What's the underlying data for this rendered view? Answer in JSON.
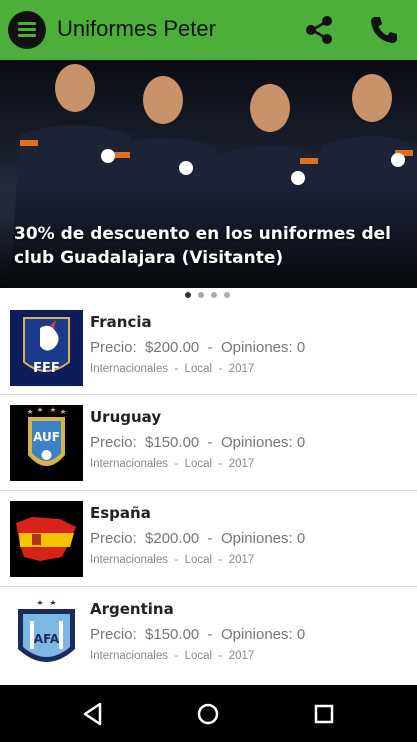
{
  "appbar": {
    "title": "Uniformes Peter",
    "menu_icon": "menu-icon",
    "share_icon": "share-icon",
    "phone_icon": "phone-icon",
    "color": "#4caf3a"
  },
  "banner": {
    "caption": "30% de descuento en los uniformes del club Guadalajara (Visitante)",
    "page_count": 4,
    "active_page": 1
  },
  "products": [
    {
      "name": "Francia",
      "price_label": "Precio:",
      "price": "$200.00",
      "reviews_label": "Opiniones:",
      "reviews": "0",
      "category": "Internacionales",
      "type": "Local",
      "year": "2017"
    },
    {
      "name": "Uruguay",
      "price_label": "Precio:",
      "price": "$150.00",
      "reviews_label": "Opiniones:",
      "reviews": "0",
      "category": "Internacionales",
      "type": "Local",
      "year": "2017"
    },
    {
      "name": "España",
      "price_label": "Precio:",
      "price": "$200.00",
      "reviews_label": "Opiniones:",
      "reviews": "0",
      "category": "Internacionales",
      "type": "Local",
      "year": "2017"
    },
    {
      "name": "Argentina",
      "price_label": "Precio:",
      "price": "$150.00",
      "reviews_label": "Opiniones:",
      "reviews": "0",
      "category": "Internacionales",
      "type": "Local",
      "year": "2017"
    }
  ],
  "separators": {
    "dash": "-",
    "dot": "·"
  },
  "logos": {
    "france": "FFF",
    "uruguay": "AUF",
    "argentina": "AFA"
  },
  "navbar": {
    "back_icon": "back-icon",
    "home_icon": "home-icon",
    "recents_icon": "recents-icon"
  }
}
